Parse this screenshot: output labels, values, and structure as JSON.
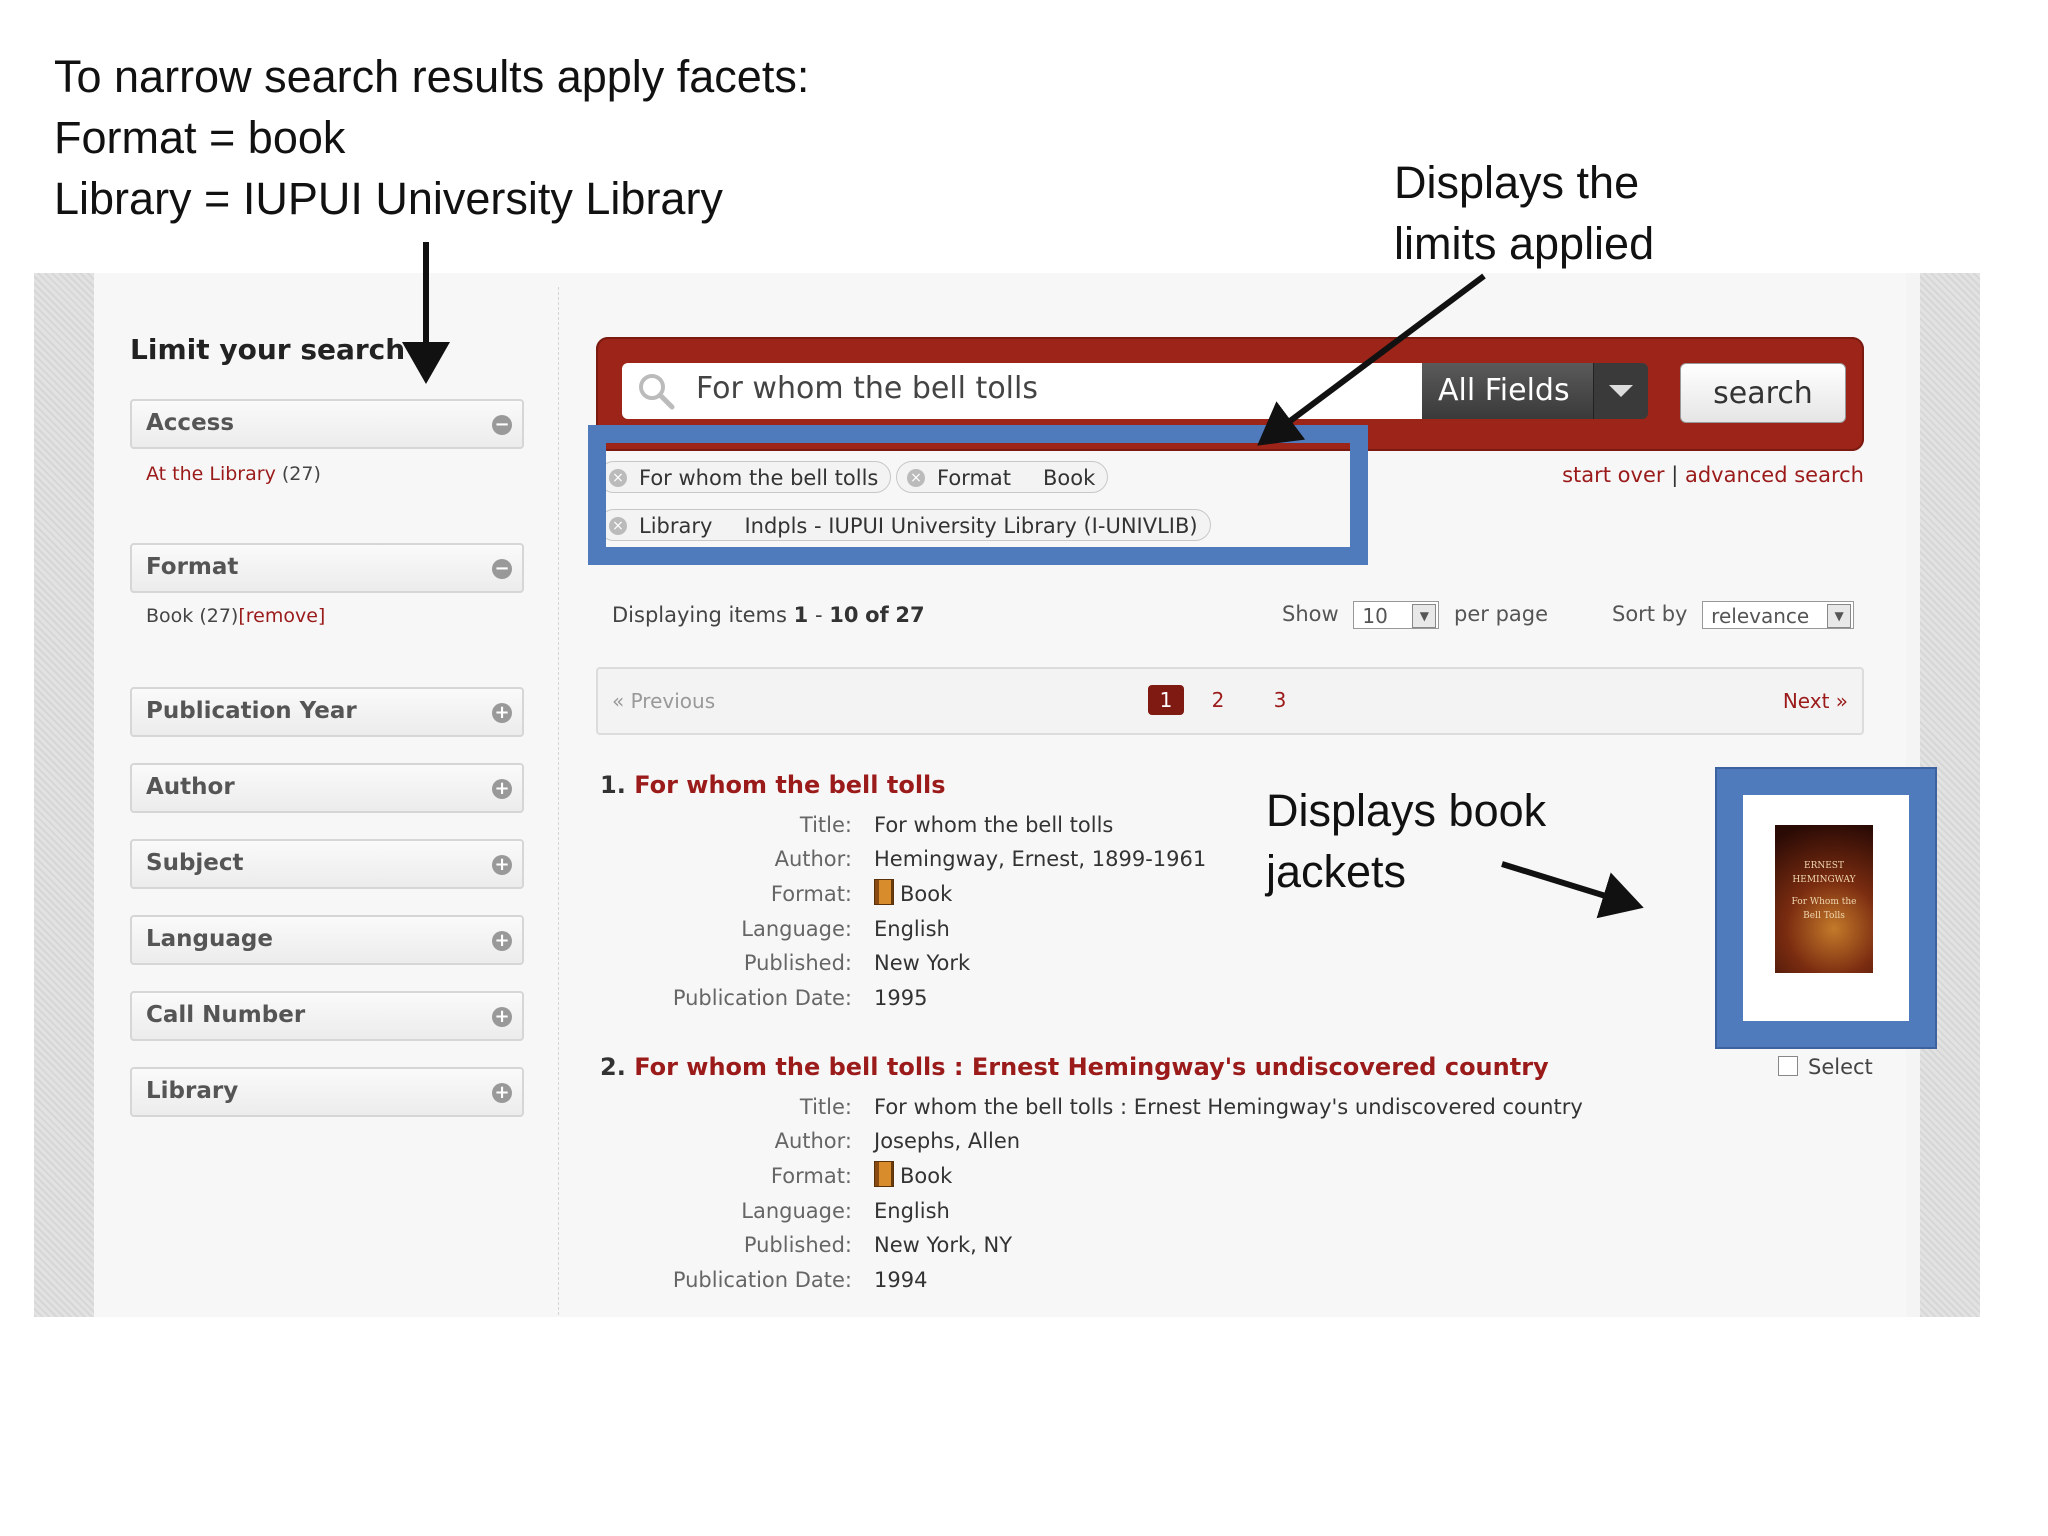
{
  "annotations": {
    "top": [
      "To narrow search results apply facets:",
      "Format = book",
      "Library = IUPUI University Library"
    ],
    "limits": [
      "Displays the",
      "limits applied"
    ],
    "jackets": [
      "Displays book",
      "jackets"
    ]
  },
  "sidebar": {
    "title": "Limit your search",
    "facets": [
      {
        "label": "Access",
        "toggle": "−",
        "value_link": "At the Library",
        "value_count": "(27)"
      },
      {
        "label": "Format",
        "toggle": "−",
        "value_text": "Book (27)",
        "remove": "[remove]"
      },
      {
        "label": "Publication Year",
        "toggle": "+"
      },
      {
        "label": "Author",
        "toggle": "+"
      },
      {
        "label": "Subject",
        "toggle": "+"
      },
      {
        "label": "Language",
        "toggle": "+"
      },
      {
        "label": "Call Number",
        "toggle": "+"
      },
      {
        "label": "Library",
        "toggle": "+"
      }
    ]
  },
  "search": {
    "query": "For whom the bell tolls",
    "field": "All Fields",
    "button": "search",
    "start_over": "start over",
    "separator": "|",
    "advanced": "advanced search"
  },
  "applied_limits": [
    {
      "label": "For whom the bell tolls",
      "value": ""
    },
    {
      "label": "Format",
      "value": "Book"
    },
    {
      "label": "Library",
      "value": "Indpls - IUPUI University Library (I-UNIVLIB)"
    }
  ],
  "results_info": {
    "prefix": "Displaying items",
    "start": "1",
    "dash": "-",
    "end": "10",
    "of": "of",
    "total": "27",
    "show_label": "Show",
    "per_page_value": "10",
    "per_page_label": "per page",
    "sort_label": "Sort by",
    "sort_value": "relevance"
  },
  "pager": {
    "prev": "« Previous",
    "next": "Next »",
    "pages": [
      "1",
      "2",
      "3"
    ],
    "current": "1"
  },
  "results": [
    {
      "num": "1.",
      "title": "For whom the bell tolls",
      "fields": [
        {
          "k": "Title:",
          "v": "For whom the bell tolls"
        },
        {
          "k": "Author:",
          "v": "Hemingway, Ernest, 1899-1961"
        },
        {
          "k": "Format:",
          "v": "Book",
          "icon": "book-icon"
        },
        {
          "k": "Language:",
          "v": "English"
        },
        {
          "k": "Published:",
          "v": "New York"
        },
        {
          "k": "Publication Date:",
          "v": "1995"
        }
      ]
    },
    {
      "num": "2.",
      "title": "For whom the bell tolls : Ernest Hemingway's undiscovered country",
      "fields": [
        {
          "k": "Title:",
          "v": "For whom the bell tolls : Ernest Hemingway's undiscovered country"
        },
        {
          "k": "Author:",
          "v": "Josephs, Allen"
        },
        {
          "k": "Format:",
          "v": "Book",
          "icon": "book-icon"
        },
        {
          "k": "Language:",
          "v": "English"
        },
        {
          "k": "Published:",
          "v": "New York, NY"
        },
        {
          "k": "Publication Date:",
          "v": "1994"
        }
      ]
    }
  ],
  "jacket": {
    "cover_lines": [
      "ERNEST",
      "HEMINGWAY",
      "For Whom the",
      "Bell Tolls"
    ],
    "select_label": "Select"
  },
  "colors": {
    "accent_red": "#9b1b1b",
    "search_bar": "#9c2418",
    "highlight_blue": "#4f7bbd"
  }
}
